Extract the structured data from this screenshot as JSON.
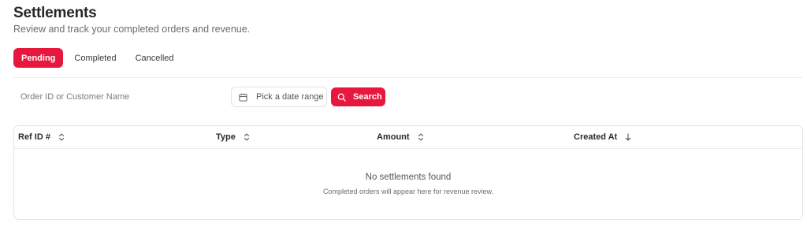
{
  "header": {
    "title": "Settlements",
    "subtitle": "Review and track your completed orders and revenue."
  },
  "tabs": [
    {
      "label": "Pending",
      "active": true
    },
    {
      "label": "Completed",
      "active": false
    },
    {
      "label": "Cancelled",
      "active": false
    }
  ],
  "filters": {
    "search_placeholder": "Order ID or Customer Name",
    "search_value": "",
    "date_range_label": "Pick a date range",
    "search_button_label": "Search"
  },
  "table": {
    "columns": [
      {
        "label": "Ref ID #",
        "sort": "unsorted",
        "icon": "sort-icon"
      },
      {
        "label": "Type",
        "sort": "unsorted",
        "icon": "sort-icon"
      },
      {
        "label": "Amount",
        "sort": "unsorted",
        "icon": "sort-icon"
      },
      {
        "label": "Created At",
        "sort": "descending",
        "icon": "arrow-down-icon"
      }
    ],
    "rows": [],
    "empty_title": "No settlements found",
    "empty_description": "Completed orders will appear here for revenue review."
  },
  "colors": {
    "accent": "#e8173d",
    "text_primary": "#26262b",
    "text_muted": "#6b6b73",
    "border": "#e4e4e8"
  }
}
